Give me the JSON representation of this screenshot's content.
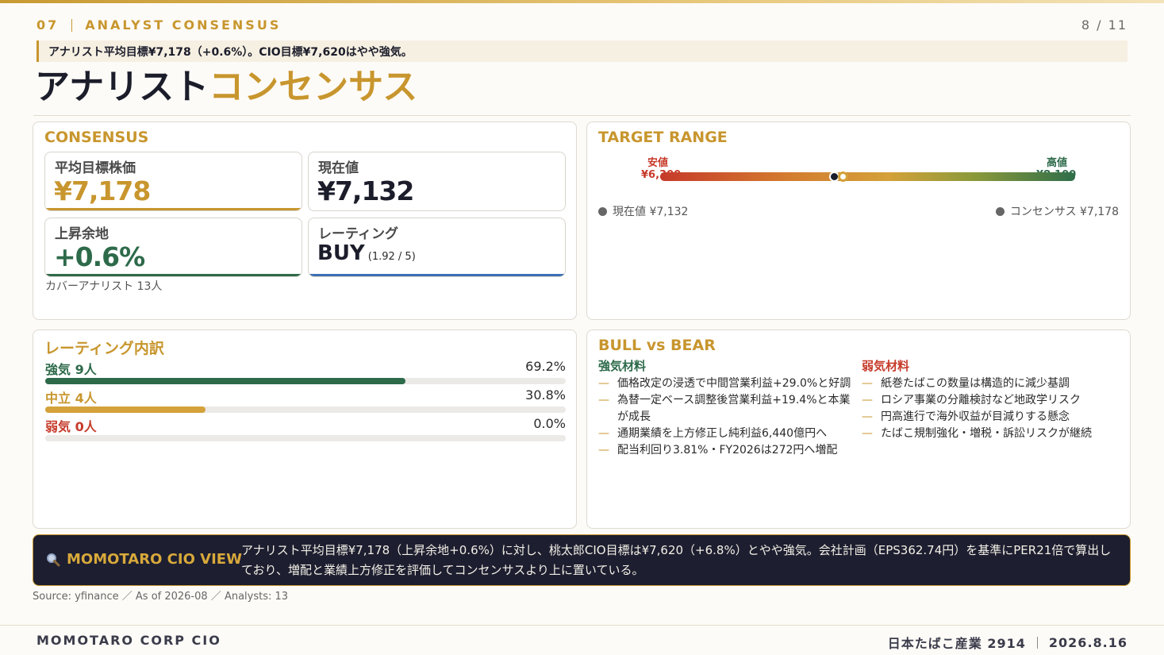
{
  "header": {
    "section_number": "07",
    "section_name": "ANALYST CONSENSUS",
    "page": "8 / 11",
    "summary": "アナリスト平均目標¥7,178（+0.6%）。CIO目標¥7,620はやや強気。",
    "title_main": "アナリスト",
    "title_accent": "コンセンサス"
  },
  "consensus": {
    "title": "CONSENSUS",
    "avg_target_label": "平均目標株価",
    "avg_target_value": "¥7,178",
    "current_label": "現在値",
    "current_value": "¥7,132",
    "upside_label": "上昇余地",
    "upside_value": "+0.6%",
    "rating_label": "レーティング",
    "rating_value": "BUY",
    "rating_score": "(1.92 / 5)",
    "covered": "カバーアナリスト 13人"
  },
  "target_range": {
    "title": "TARGET RANGE",
    "low_label": "安値",
    "low_value": "¥6,300",
    "high_label": "高値",
    "high_value": "¥8,100",
    "current_position": 0.42,
    "consensus_position": 0.44,
    "legend_current": "現在値 ¥7,132",
    "legend_consensus": "コンセンサス ¥7,178"
  },
  "rating_breakdown": {
    "title": "レーティング内訳",
    "rows": [
      {
        "label": "強気 9人",
        "pct": "69.2%",
        "value": 0.692,
        "color": "#2d6a4a"
      },
      {
        "label": "中立 4人",
        "pct": "30.8%",
        "value": 0.308,
        "color": "#d4a13a"
      },
      {
        "label": "弱気 0人",
        "pct": "0.0%",
        "value": 0.0,
        "color": "#c63a2a"
      }
    ]
  },
  "bull_bear": {
    "title": "BULL vs BEAR",
    "bull_head": "強気材料",
    "bull_items": [
      "価格改定の浸透で中間営業利益+29.0%と好調",
      "為替一定ベース調整後営業利益+19.4%と本業が成長",
      "通期業績を上方修正し純利益6,440億円へ",
      "配当利回り3.81%・FY2026は272円へ増配"
    ],
    "bear_head": "弱気材料",
    "bear_items": [
      "紙巻たばこの数量は構造的に減少基調",
      "ロシア事業の分離検討など地政学リスク",
      "円高進行で海外収益が目減りする懸念",
      "たばこ規制強化・増税・訴訟リスクが継続"
    ],
    "dash": "—"
  },
  "cio": {
    "title": "MOMOTARO CIO VIEW",
    "text": "アナリスト平均目標¥7,178（上昇余地+0.6%）に対し、桃太郎CIO目標は¥7,620（+6.8%）とやや強気。会社計画（EPS362.74円）を基準にPER21倍で算出しており、増配と業績上方修正を評価してコンセンサスより上に置いている。"
  },
  "source": "Source: yfinance ／ As of 2026-08 ／ Analysts: 13",
  "footer": {
    "brand": "MOMOTARO CORP CIO",
    "company": "日本たばこ産業 2914",
    "date": "2026.8.16"
  },
  "colors": {
    "gold": "#c8962e",
    "green": "#2d6a4a",
    "red": "#c63a2a",
    "blue": "#3d6fb4",
    "navy": "#1d1e30"
  }
}
